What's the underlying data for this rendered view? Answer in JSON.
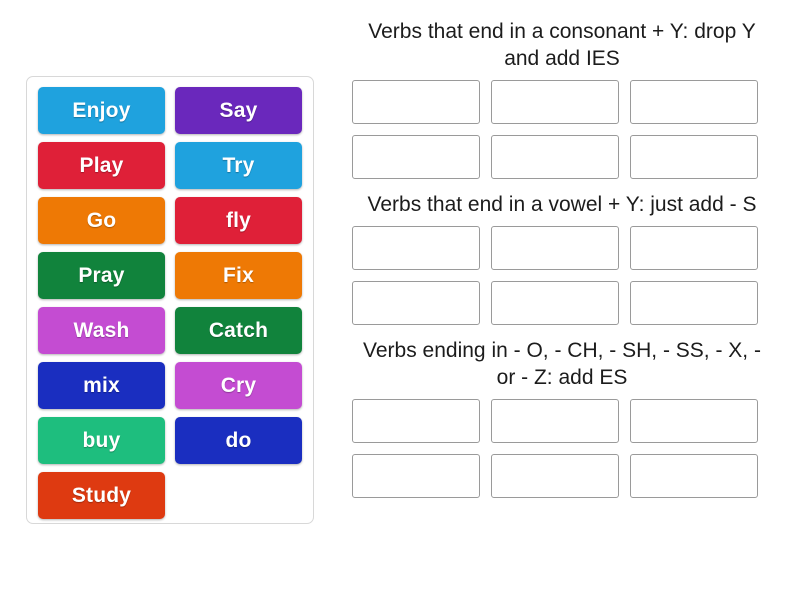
{
  "activity": {
    "type": "group-sort",
    "tile_bank": {
      "name": "word-tile-bank",
      "tiles": [
        {
          "label": "Enjoy",
          "color": "#1FA2DE"
        },
        {
          "label": "Say",
          "color": "#6A28BC"
        },
        {
          "label": "Play",
          "color": "#DF2038"
        },
        {
          "label": "Try",
          "color": "#1FA2DE"
        },
        {
          "label": "Go",
          "color": "#EE7905"
        },
        {
          "label": "fly",
          "color": "#DF2038"
        },
        {
          "label": "Pray",
          "color": "#11833C"
        },
        {
          "label": "Fix",
          "color": "#EE7905"
        },
        {
          "label": "Wash",
          "color": "#C44CD2"
        },
        {
          "label": "Catch",
          "color": "#11833C"
        },
        {
          "label": "mix",
          "color": "#1A2EC0"
        },
        {
          "label": "Cry",
          "color": "#C44CD2"
        },
        {
          "label": "buy",
          "color": "#1EBE7E"
        },
        {
          "label": "do",
          "color": "#1A2EC0"
        },
        {
          "label": "Study",
          "color": "#DE3A11"
        }
      ]
    },
    "groups": [
      {
        "title": "Verbs that end in a consonant + Y: drop Y and add IES",
        "slots": [
          "",
          "",
          "",
          "",
          "",
          ""
        ]
      },
      {
        "title": "Verbs that end in a vowel + Y: just add - S",
        "slots": [
          "",
          "",
          "",
          "",
          "",
          ""
        ]
      },
      {
        "title": "Verbs ending in - O, - CH, - SH, - SS, - X, - or - Z: add ES",
        "slots": [
          "",
          "",
          "",
          "",
          "",
          ""
        ]
      }
    ]
  },
  "colors": {
    "page_background": "#FFFFFF",
    "panel_border": "#D8D8D8",
    "slot_border": "#9A9A9A",
    "text": "#1C1C1C",
    "tile_text": "#FFFFFF"
  }
}
